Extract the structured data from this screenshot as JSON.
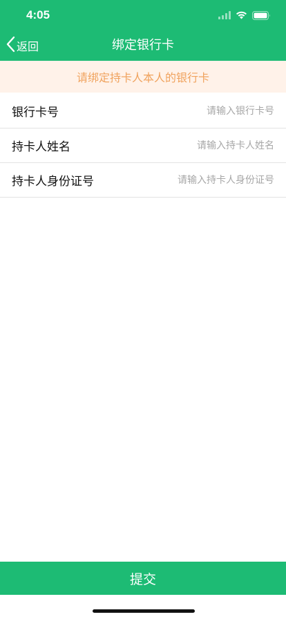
{
  "status_bar": {
    "time": "4:05",
    "icons": [
      "signal-icon",
      "wifi-icon",
      "battery-icon"
    ]
  },
  "nav": {
    "back_label": "返回",
    "title": "绑定银行卡"
  },
  "notice": {
    "text": "请绑定持卡人本人的银行卡"
  },
  "form": {
    "fields": [
      {
        "label": "银行卡号",
        "placeholder": "请输入银行卡号",
        "value": ""
      },
      {
        "label": "持卡人姓名",
        "placeholder": "请输入持卡人姓名",
        "value": ""
      },
      {
        "label": "持卡人身份证号",
        "placeholder": "请输入持卡人身份证号",
        "value": ""
      }
    ]
  },
  "submit": {
    "label": "提交"
  },
  "colors": {
    "primary": "#1dbb74",
    "notice_bg": "#fff2e9",
    "notice_text": "#f0a35e",
    "placeholder": "#a7a7a7",
    "divider": "#e3e3e3"
  }
}
